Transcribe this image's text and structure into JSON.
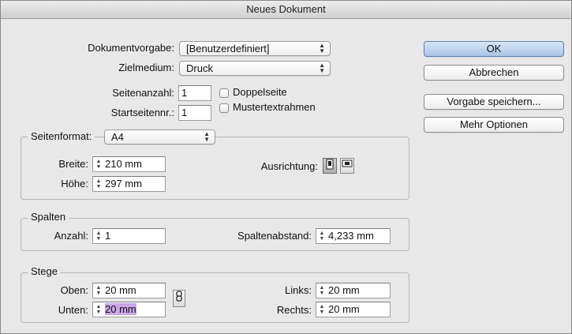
{
  "window": {
    "title": "Neues Dokument"
  },
  "dokumentvorgabe": {
    "label": "Dokumentvorgabe:",
    "value": "[Benutzerdefiniert]"
  },
  "zielmedium": {
    "label": "Zielmedium:",
    "value": "Druck"
  },
  "seitenanzahl": {
    "label": "Seitenanzahl:",
    "value": "1"
  },
  "startseitennr": {
    "label": "Startseitennr.:",
    "value": "1"
  },
  "doppelseite": {
    "label": "Doppelseite",
    "checked": false
  },
  "mustertextrahmen": {
    "label": "Mustertextrahmen",
    "checked": false
  },
  "seitenformat": {
    "label": "Seitenformat:",
    "value": "A4",
    "breite": {
      "label": "Breite:",
      "value": "210 mm"
    },
    "hoehe": {
      "label": "Höhe:",
      "value": "297 mm"
    },
    "ausrichtung": {
      "label": "Ausrichtung:",
      "icons": [
        "portrait-icon",
        "landscape-icon"
      ],
      "selected": "portrait"
    }
  },
  "spalten": {
    "title": "Spalten",
    "anzahl": {
      "label": "Anzahl:",
      "value": "1"
    },
    "spaltenabstand": {
      "label": "Spaltenabstand:",
      "value": "4,233 mm"
    }
  },
  "stege": {
    "title": "Stege",
    "oben": {
      "label": "Oben:",
      "value": "20 mm"
    },
    "unten": {
      "label": "Unten:",
      "value": "20 mm"
    },
    "links": {
      "label": "Links:",
      "value": "20 mm"
    },
    "rechts": {
      "label": "Rechts:",
      "value": "20 mm"
    }
  },
  "buttons": {
    "ok": "OK",
    "abbrechen": "Abbrechen",
    "vorgabe_speichern": "Vorgabe speichern...",
    "mehr_optionen": "Mehr Optionen"
  },
  "colors": {
    "default_button": "#a8c4e6",
    "selection": "#c9a6e8"
  }
}
